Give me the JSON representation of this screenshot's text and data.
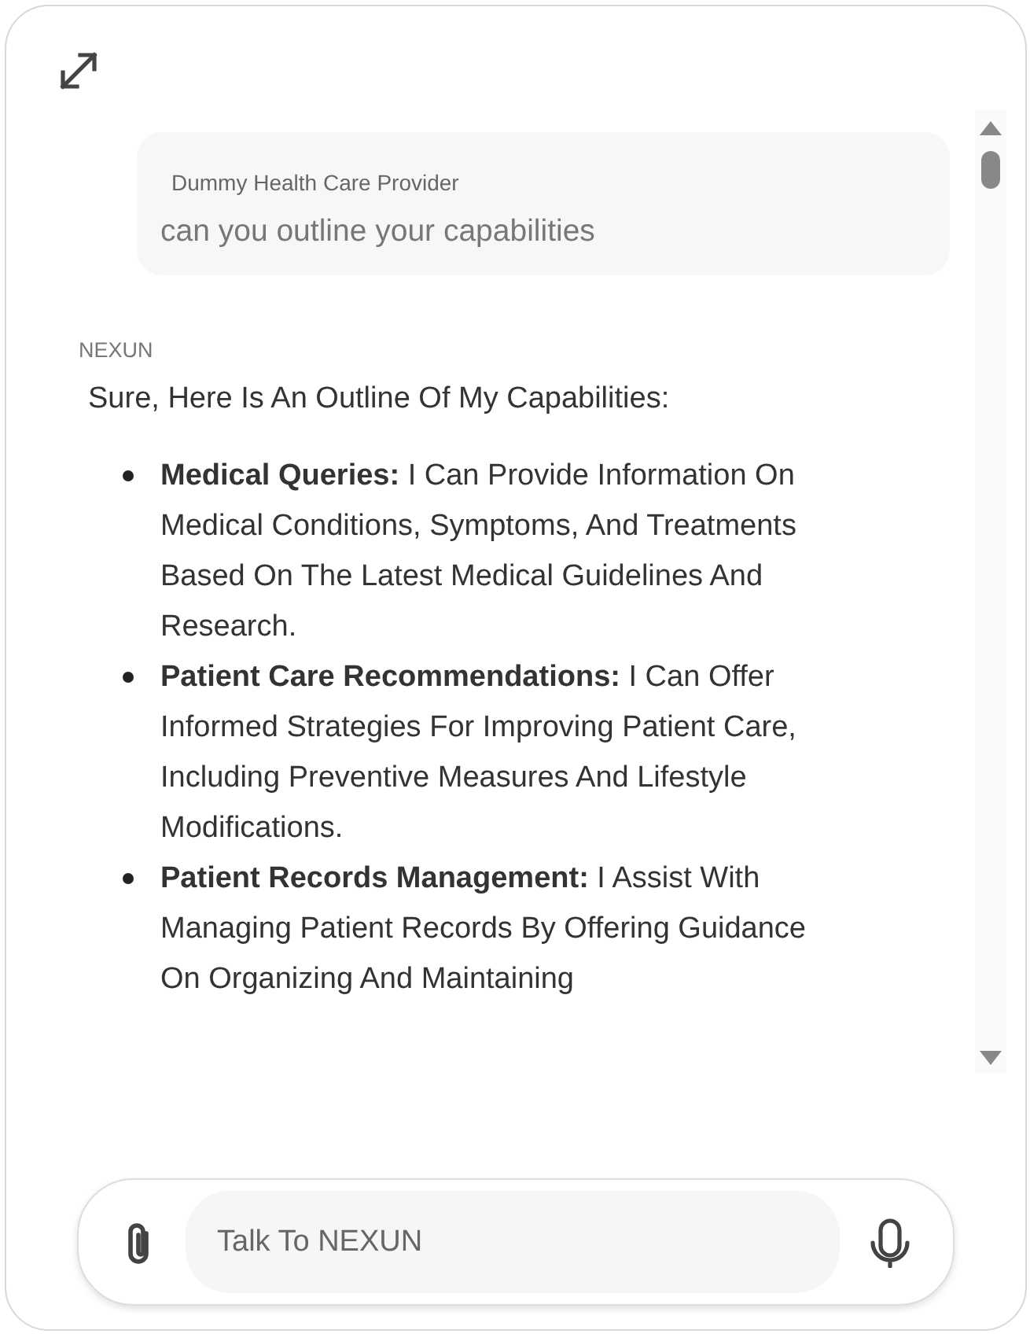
{
  "user_message": {
    "sender": "Dummy Health Care Provider",
    "text": "can you outline your capabilities"
  },
  "reply": {
    "sender": "NEXUN",
    "intro": "Sure, Here Is An Outline Of My Capabilities:",
    "items": [
      {
        "text": "**Medical Queries:** I Can Provide Information On Medical Conditions, Symptoms, And Treatments Based On The Latest Medical Guidelines And Research."
      },
      {
        "text": "**Patient Care Recommendations:** I Can Offer Informed Strategies For Improving Patient Care, Including Preventive Measures And Lifestyle Modifications."
      },
      {
        "text": "**Patient Records Management:** I Assist With Managing Patient Records By Offering Guidance On Organizing And Maintaining"
      }
    ]
  },
  "composer": {
    "placeholder": "Talk To NEXUN"
  }
}
